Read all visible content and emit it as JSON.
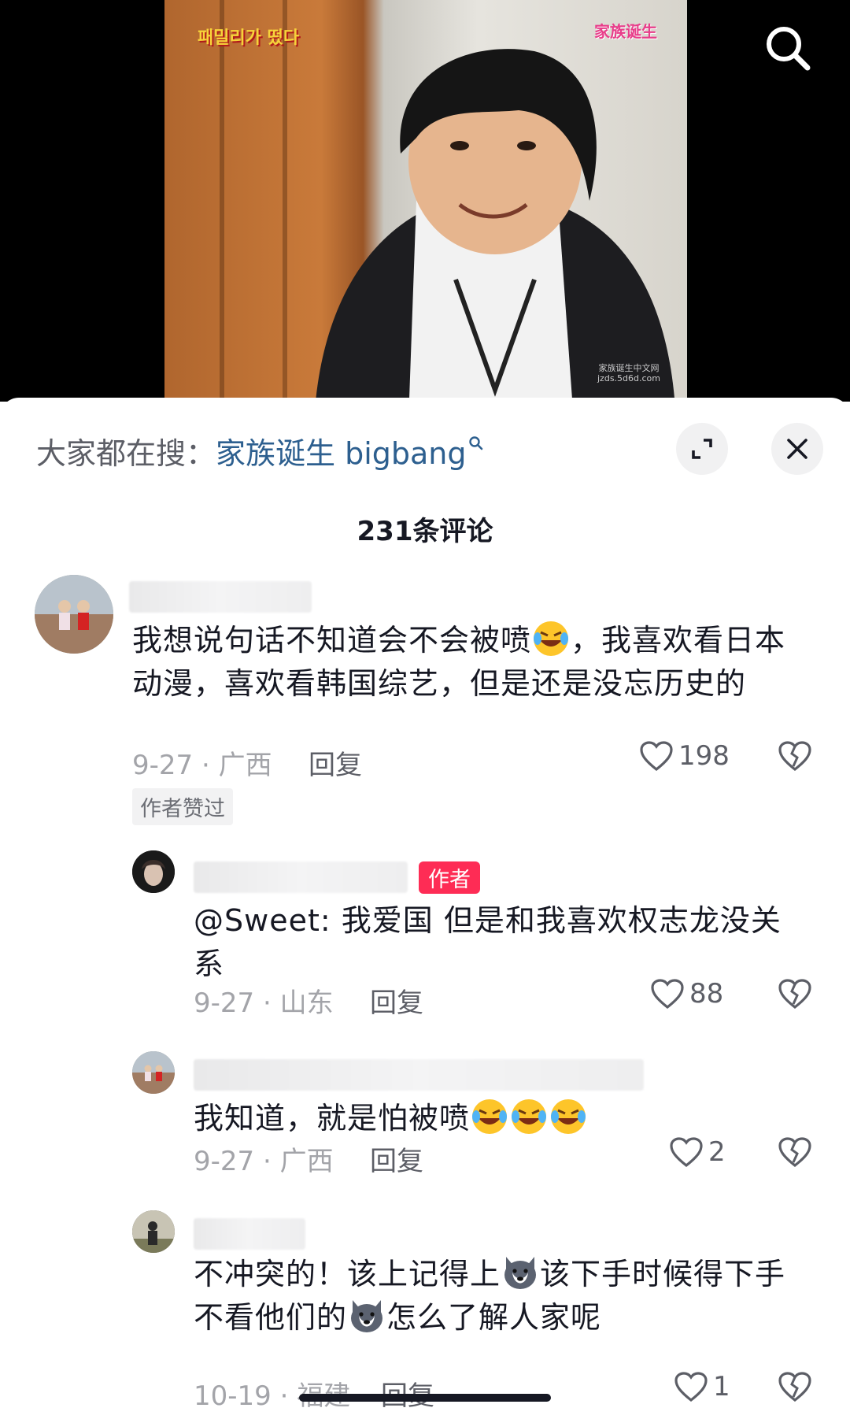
{
  "header": {
    "search_prefix": "大家都在搜：",
    "search_term": "家族诞生 bigbang",
    "comment_count": "231条评论"
  },
  "video": {
    "logo_left": "패밀리가 떴다",
    "logo_right": "家族诞生",
    "watermark_line1": "家族诞生中文网",
    "watermark_line2": "jzds.5d6d.com"
  },
  "comments": [
    {
      "text_a": "我想说句话不知道会不会被喷",
      "text_b": "，我喜欢看日本动漫，喜欢看韩国综艺，但是还是没忘历史的",
      "date_location": "9-27 · 广西",
      "reply_label": "回复",
      "likes": "198",
      "badge": "作者赞过"
    },
    {
      "author_tag": "作者",
      "text": "@Sweet: 我爱国 但是和我喜欢权志龙没关系",
      "date_location": "9-27 · 山东",
      "reply_label": "回复",
      "likes": "88"
    },
    {
      "text": "我知道，就是怕被喷",
      "date_location": "9-27 · 广西",
      "reply_label": "回复",
      "likes": "2"
    },
    {
      "text_a": "不冲突的！该上记得上",
      "text_b": "该下手时候得下手",
      "text_c": "不看他们的",
      "text_d": "怎么了解人家呢",
      "date_location": "10-19 · 福建",
      "reply_label": "回复",
      "likes": "1"
    }
  ],
  "icons": {
    "search": "search-icon",
    "expand": "expand-icon",
    "close": "close-icon",
    "like": "heart-icon",
    "dislike": "broken-heart-icon",
    "emoji_laugh": "laugh-cry-emoji",
    "emoji_husky": "husky-emoji",
    "emoji_doge": "doge-emoji"
  },
  "colors": {
    "search_term": "#2d5f8f",
    "author_tag": "#fe2c55",
    "meta_text": "#a3a4a9"
  }
}
